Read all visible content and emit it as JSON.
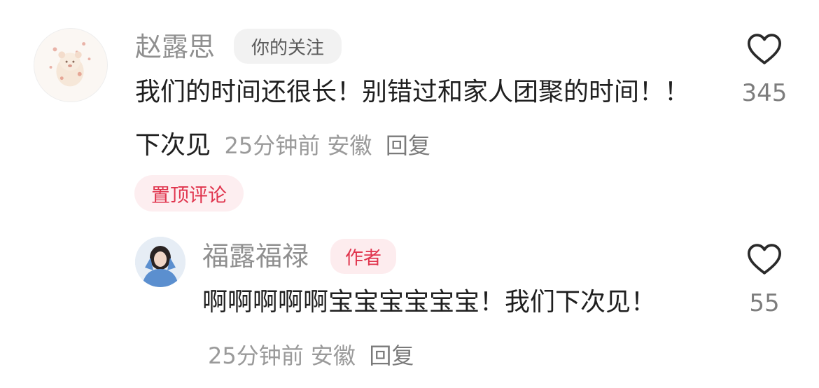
{
  "comment": {
    "username": "赵露思",
    "tag": "你的关注",
    "content": "我们的时间还很长！别错过和家人团聚的时间！！下次见",
    "meta": "25分钟前 安徽",
    "reply_label": "回复",
    "pinned_label": "置顶评论",
    "like_count": "345",
    "like_icon": "heart-outline-icon"
  },
  "reply": {
    "username": "福露福禄",
    "tag": "作者",
    "content": "啊啊啊啊啊宝宝宝宝宝宝！我们下次见！",
    "meta": "25分钟前 安徽",
    "reply_label": "回复",
    "like_count": "55",
    "like_icon": "heart-outline-icon"
  },
  "colors": {
    "username": "#8f8f8f",
    "text": "#1f1f1f",
    "meta": "#9a9a9a",
    "tag_bg": "#f2f2f2",
    "tag_text": "#5a5a5a",
    "author_tag_bg": "#fdecee",
    "author_tag_text": "#e0344d",
    "pinned_bg": "#fdeef0",
    "pinned_text": "#e0344d"
  }
}
